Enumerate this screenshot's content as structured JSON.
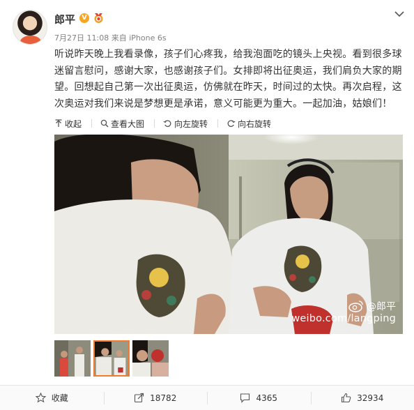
{
  "post": {
    "author": "郎平",
    "verified_badge": "V",
    "timestamp": "7月27日 11:08",
    "source_prefix": "来自",
    "source": "iPhone 6s",
    "content_lines": [
      "听说昨天晚上我看录像，孩子们心疼我，给我泡面吃的镜头上央视。看到很多球",
      "迷留言慰问，感谢大家，也感谢孩子们。女排即将出征奥运，我们肩负大家的期",
      "望。回想起自己第一次出征奥运，仿佛就在昨天，时间过的太快。再次启程，这",
      "次奥运对我们来说是梦想更是承诺，意义可能更为重大。一起加油，姑娘们！"
    ]
  },
  "toolbar": {
    "collapse": "收起",
    "view_large": "查看大图",
    "rotate_left": "向左旋转",
    "rotate_right": "向右旋转"
  },
  "watermark": {
    "handle": "@郎平",
    "url": "weibo.com/langping"
  },
  "thumbnails": {
    "count": 3,
    "active_index": 1
  },
  "footer": {
    "favorite": "收藏",
    "repost_count": "18782",
    "comment_count": "4365",
    "like_count": "32934"
  },
  "icons": {
    "chevron": "chevron-down-icon",
    "collapse": "arrow-up-icon",
    "view_large": "magnifier-icon",
    "rotate_left": "rotate-left-icon",
    "rotate_right": "rotate-right-icon",
    "favorite": "star-icon",
    "repost": "repost-icon",
    "comment": "comment-icon",
    "like": "thumbs-up-icon"
  },
  "colors": {
    "verified": "#f6a623",
    "thumb_active": "#f07a2d",
    "text": "#333333",
    "meta": "#808080"
  }
}
